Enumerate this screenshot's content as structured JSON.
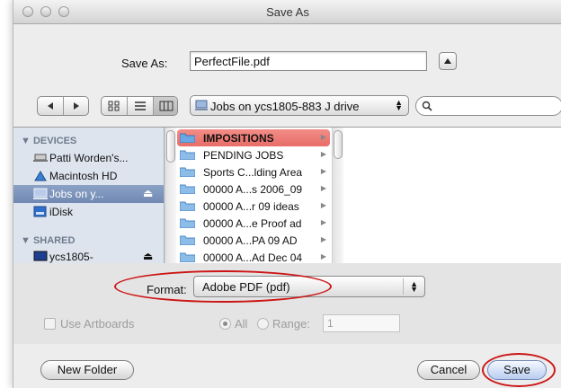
{
  "window": {
    "title": "Save As"
  },
  "saveas": {
    "label": "Save As:",
    "value": "PerfectFile.pdf"
  },
  "toolbar": {
    "location": "Jobs on ycs1805-883 J drive",
    "search_placeholder": ""
  },
  "sidebar": {
    "devices_header": "DEVICES",
    "shared_header": "SHARED",
    "items": [
      {
        "label": "Patti Worden's..."
      },
      {
        "label": "Macintosh HD"
      },
      {
        "label": "Jobs on y..."
      },
      {
        "label": "iDisk"
      },
      {
        "label": "ycs1805-"
      }
    ]
  },
  "files": [
    {
      "label": "IMPOSITIONS"
    },
    {
      "label": "PENDING JOBS"
    },
    {
      "label": "Sports C...lding Area"
    },
    {
      "label": "00000 A...s 2006_09"
    },
    {
      "label": "00000 A...r 09 ideas"
    },
    {
      "label": "00000 A...e Proof ad"
    },
    {
      "label": "00000 A...PA 09 AD"
    },
    {
      "label": "00000 A...Ad Dec 04"
    }
  ],
  "format": {
    "label": "Format:",
    "value": "Adobe PDF (pdf)"
  },
  "options": {
    "artboards_label": "Use Artboards",
    "all_label": "All",
    "range_label": "Range:",
    "range_value": "1"
  },
  "buttons": {
    "new_folder": "New Folder",
    "cancel": "Cancel",
    "save": "Save"
  },
  "colors": {
    "annotation_red": "#cc1616",
    "selection_red": "#e86d68",
    "sidebar_bg": "#dde4ee"
  }
}
